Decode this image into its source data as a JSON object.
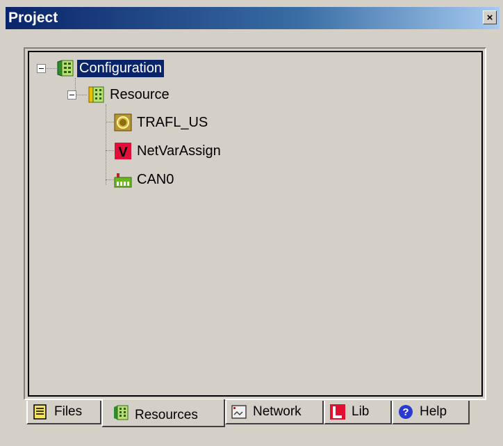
{
  "window": {
    "title": "Project",
    "close_glyph": "×"
  },
  "tree": {
    "nodes": [
      {
        "label": "Configuration",
        "icon": "configuration-icon",
        "selected": true
      },
      {
        "label": "Resource",
        "icon": "resource-icon",
        "selected": false
      },
      {
        "label": "TRAFL_US",
        "icon": "program-icon",
        "selected": false
      },
      {
        "label": "NetVarAssign",
        "icon": "netvar-icon",
        "selected": false
      },
      {
        "label": "CAN0",
        "icon": "can-icon",
        "selected": false
      }
    ]
  },
  "tabs": [
    {
      "label": "Files",
      "icon": "files-icon",
      "active": false
    },
    {
      "label": "Resources",
      "icon": "resources-icon",
      "active": true
    },
    {
      "label": "Network",
      "icon": "network-icon",
      "active": false
    },
    {
      "label": "Lib",
      "icon": "lib-icon",
      "active": false
    },
    {
      "label": "Help",
      "icon": "help-icon",
      "active": false
    }
  ],
  "colors": {
    "face": "#d4d0c8",
    "title_start": "#0a246a",
    "title_end": "#a6caf0",
    "selection": "#0a246a"
  }
}
